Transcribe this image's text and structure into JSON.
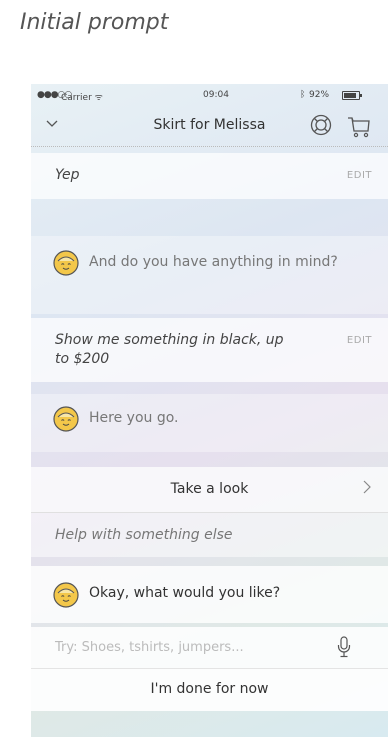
{
  "caption": "Initial prompt",
  "status_bar": {
    "signal": "●●●○○",
    "carrier": "Carrier ᯤ",
    "time": "09:04",
    "bluetooth": "ᛒ",
    "battery": "92%"
  },
  "nav": {
    "title": "Skirt for Melissa",
    "back_icon": "chevron-down-icon",
    "icons": [
      "support-icon",
      "cart-icon"
    ]
  },
  "conversation": {
    "user_reply_1": {
      "text": "Yep",
      "edit_label": "EDIT"
    },
    "bot_message_1": "And do you have anything in mind?",
    "user_reply_2": {
      "text": "Show me something in black, up to $200",
      "edit_label": "EDIT"
    },
    "bot_message_2": "Here you go.",
    "take_look": "Take a look",
    "help_option": "Help with something else",
    "bot_message_3": "Okay, what would you like?"
  },
  "input": {
    "placeholder": "Try: Shoes, tshirts, jumpers..."
  },
  "done_button": "I'm done for now",
  "colors": {
    "bot_face": "#f3c74a",
    "accent_text": "#333333"
  }
}
